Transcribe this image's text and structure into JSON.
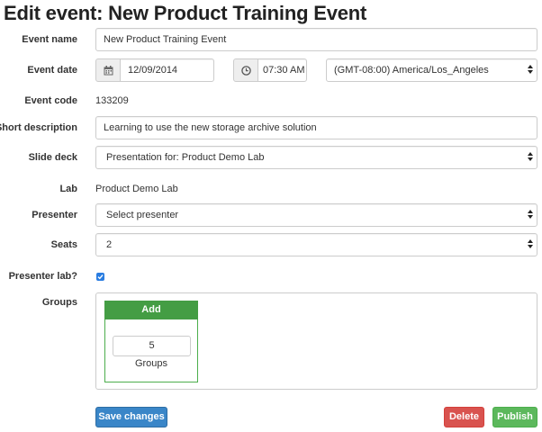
{
  "page": {
    "title": "Edit event: New Product Training Event"
  },
  "form": {
    "event_name": {
      "label": "Event name",
      "value": "New Product Training Event"
    },
    "event_date": {
      "label": "Event date",
      "date_value": "12/09/2014",
      "time_value": "07:30 AM",
      "timezone_value": "(GMT-08:00) America/Los_Angeles"
    },
    "event_code": {
      "label": "Event code",
      "value": "133209"
    },
    "short_description": {
      "label": "Short description",
      "value": "Learning to use the new storage archive solution"
    },
    "slide_deck": {
      "label": "Slide deck",
      "value": "Presentation for: Product Demo Lab"
    },
    "lab": {
      "label": "Lab",
      "value": "Product Demo Lab"
    },
    "presenter": {
      "label": "Presenter",
      "value": "Select presenter"
    },
    "seats": {
      "label": "Seats",
      "value": "2"
    },
    "presenter_lab": {
      "label": "Presenter lab?",
      "checked": true
    },
    "groups": {
      "label": "Groups",
      "add_label": "Add",
      "count_value": "5",
      "count_caption": "Groups"
    }
  },
  "actions": {
    "save_label": "Save changes",
    "delete_label": "Delete",
    "publish_label": "Publish"
  },
  "icons": {
    "calendar": "calendar-icon",
    "clock": "clock-icon",
    "check": "check-icon",
    "select_arrows": "chevron-updown-icon"
  },
  "colors": {
    "primary": "#3a86c8",
    "danger": "#d9534f",
    "success": "#5cb85c",
    "add_header": "#449d44",
    "checkbox": "#2a7de1"
  }
}
